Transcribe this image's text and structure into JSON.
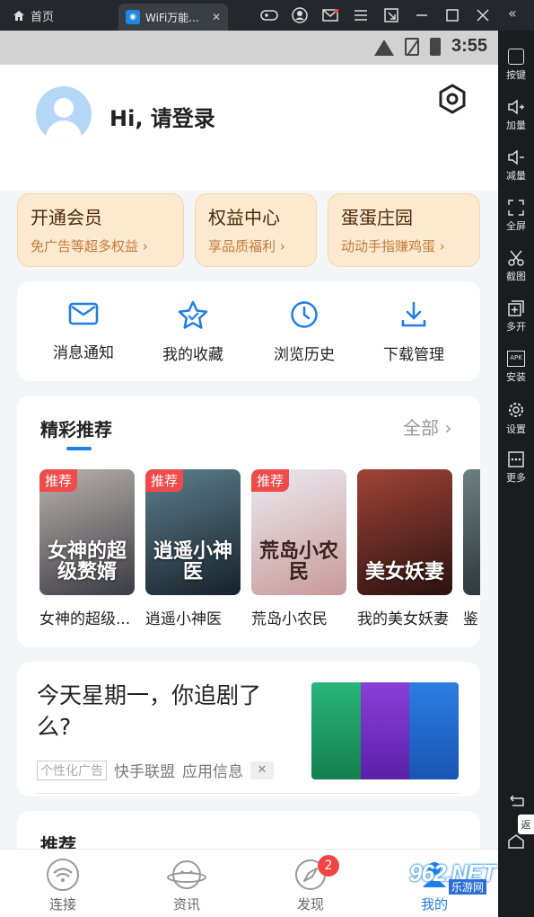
{
  "emulator": {
    "home_label": "首页",
    "tab_title": "WiFi万能...",
    "tab_close": "✕",
    "toolbar": [
      {
        "label": "按键",
        "icon": "keyboard-icon"
      },
      {
        "label": "加量",
        "icon": "volume-up-icon"
      },
      {
        "label": "减量",
        "icon": "volume-down-icon"
      },
      {
        "label": "全屏",
        "icon": "fullscreen-icon"
      },
      {
        "label": "截图",
        "icon": "scissors-icon"
      },
      {
        "label": "多开",
        "icon": "multi-instance-icon"
      },
      {
        "label": "安装",
        "icon": "apk-icon"
      },
      {
        "label": "设置",
        "icon": "gear-icon"
      },
      {
        "label": "更多",
        "icon": "more-icon"
      }
    ],
    "apk_text": "APK",
    "tooltip": "返"
  },
  "status_bar": {
    "time": "3:55"
  },
  "profile": {
    "greeting": "Hi, 请登录"
  },
  "perks": [
    {
      "title": "开通会员",
      "subtitle": "免广告等超多权益 ›"
    },
    {
      "title": "权益中心",
      "subtitle": "享品质福利 ›"
    },
    {
      "title": "蛋蛋庄园",
      "subtitle": "动动手指赚鸡蛋 ›"
    }
  ],
  "quick_actions": [
    {
      "label": "消息通知",
      "icon": "mail-icon"
    },
    {
      "label": "我的收藏",
      "icon": "star-icon"
    },
    {
      "label": "浏览历史",
      "icon": "clock-icon"
    },
    {
      "label": "下载管理",
      "icon": "download-icon"
    }
  ],
  "featured": {
    "title": "精彩推荐",
    "all_label": "全部 ›",
    "tag_label": "推荐",
    "books": [
      {
        "title": "女神的超级...",
        "cover_text": "女神的超级赘婿",
        "tagged": true,
        "colors": [
          "#3b3b44",
          "#b9b3ad"
        ]
      },
      {
        "title": "逍遥小神医",
        "cover_text": "逍遥小神医",
        "tagged": true,
        "colors": [
          "#17222c",
          "#5d7e8c"
        ]
      },
      {
        "title": "荒岛小农民",
        "cover_text": "荒岛小农民",
        "tagged": true,
        "colors": [
          "#eaeaf0",
          "#c99a9a"
        ]
      },
      {
        "title": "我的美女妖妻",
        "cover_text": "美女妖妻",
        "tagged": false,
        "colors": [
          "#2a1210",
          "#a04338"
        ]
      },
      {
        "title": "鉴",
        "cover_text": "",
        "tagged": false,
        "colors": [
          "#20282a",
          "#6e7f82"
        ]
      }
    ]
  },
  "ad": {
    "title": "今天星期一，你追剧了么?",
    "tag": "个性化广告",
    "source": "快手联盟",
    "info": "应用信息",
    "close": "✕"
  },
  "recommend": {
    "title": "推荐"
  },
  "bottom_nav": [
    {
      "label": "连接",
      "icon": "wifi-icon"
    },
    {
      "label": "资讯",
      "icon": "planet-face-icon"
    },
    {
      "label": "发现",
      "icon": "compass-icon",
      "badge": "2"
    },
    {
      "label": "我的",
      "icon": "profile-icon"
    }
  ],
  "watermark": {
    "number": "962.NET",
    "site": "乐游网"
  }
}
